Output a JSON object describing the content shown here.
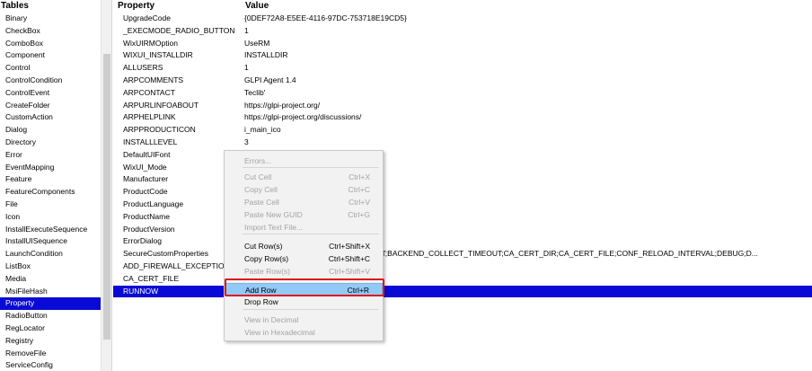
{
  "tables": {
    "header": "Tables",
    "items": [
      "Binary",
      "CheckBox",
      "ComboBox",
      "Component",
      "Control",
      "ControlCondition",
      "ControlEvent",
      "CreateFolder",
      "CustomAction",
      "Dialog",
      "Directory",
      "Error",
      "EventMapping",
      "Feature",
      "FeatureComponents",
      "File",
      "Icon",
      "InstallExecuteSequence",
      "InstallUISequence",
      "LaunchCondition",
      "ListBox",
      "Media",
      "MsiFileHash",
      "Property",
      "RadioButton",
      "RegLocator",
      "Registry",
      "RemoveFile",
      "ServiceConfig"
    ],
    "selected": "Property"
  },
  "grid": {
    "header_property": "Property",
    "header_value": "Value",
    "rows": [
      {
        "property": "UpgradeCode",
        "value": "{0DEF72A8-E5EE-4116-97DC-753718E19CD5}"
      },
      {
        "property": "_EXECMODE_RADIO_BUTTON",
        "value": "1"
      },
      {
        "property": "WixUIRMOption",
        "value": "UseRM"
      },
      {
        "property": "WIXUI_INSTALLDIR",
        "value": "INSTALLDIR"
      },
      {
        "property": "ALLUSERS",
        "value": "1"
      },
      {
        "property": "ARPCOMMENTS",
        "value": "GLPI Agent 1.4"
      },
      {
        "property": "ARPCONTACT",
        "value": "Teclib'"
      },
      {
        "property": "ARPURLINFOABOUT",
        "value": "https://glpi-project.org/"
      },
      {
        "property": "ARPHELPLINK",
        "value": "https://glpi-project.org/discussions/"
      },
      {
        "property": "ARPPRODUCTICON",
        "value": "i_main_ico"
      },
      {
        "property": "INSTALLLEVEL",
        "value": "3"
      },
      {
        "property": "DefaultUIFont",
        "value": ""
      },
      {
        "property": "WixUI_Mode",
        "value": ""
      },
      {
        "property": "Manufacturer",
        "value": ""
      },
      {
        "property": "ProductCode",
        "value": ""
      },
      {
        "property": "ProductLanguage",
        "value": ""
      },
      {
        "property": "ProductName",
        "value": ""
      },
      {
        "property": "ProductVersion",
        "value": ""
      },
      {
        "property": "ErrorDialog",
        "value": ""
      },
      {
        "property": "SecureCustomProperties",
        "value": "L_EXCEPTION;ADDITIONAL_CONTENT;BACKEND_COLLECT_TIMEOUT;CA_CERT_DIR;CA_CERT_FILE;CONF_RELOAD_INTERVAL;DEBUG;D..."
      },
      {
        "property": "ADD_FIREWALL_EXCEPTION",
        "value": ""
      },
      {
        "property": "CA_CERT_FILE",
        "value": ""
      },
      {
        "property": "RUNNOW",
        "value": ""
      }
    ],
    "selected": "RUNNOW"
  },
  "context_menu": {
    "items": [
      {
        "label": "Errors...",
        "shortcut": "",
        "enabled": false
      },
      {
        "label": "Cut Cell",
        "shortcut": "Ctrl+X",
        "enabled": false
      },
      {
        "label": "Copy Cell",
        "shortcut": "Ctrl+C",
        "enabled": false
      },
      {
        "label": "Paste Cell",
        "shortcut": "Ctrl+V",
        "enabled": false
      },
      {
        "label": "Paste New GUID",
        "shortcut": "Ctrl+G",
        "enabled": false
      },
      {
        "label": "Import Text File...",
        "shortcut": "",
        "enabled": false
      },
      {
        "label": "Cut Row(s)",
        "shortcut": "Ctrl+Shift+X",
        "enabled": true
      },
      {
        "label": "Copy Row(s)",
        "shortcut": "Ctrl+Shift+C",
        "enabled": true
      },
      {
        "label": "Paste Row(s)",
        "shortcut": "Ctrl+Shift+V",
        "enabled": false
      },
      {
        "label": "Add Row",
        "shortcut": "Ctrl+R",
        "enabled": true,
        "highlighted": true
      },
      {
        "label": "Drop Row",
        "shortcut": "",
        "enabled": true
      },
      {
        "label": "View in Decimal",
        "shortcut": "",
        "enabled": false
      },
      {
        "label": "View in Hexadecimal",
        "shortcut": "",
        "enabled": false
      }
    ]
  },
  "colors": {
    "selection": "#0a0ad6",
    "menu_highlight": "#91c9f7",
    "annotation_box": "#e0161a"
  }
}
